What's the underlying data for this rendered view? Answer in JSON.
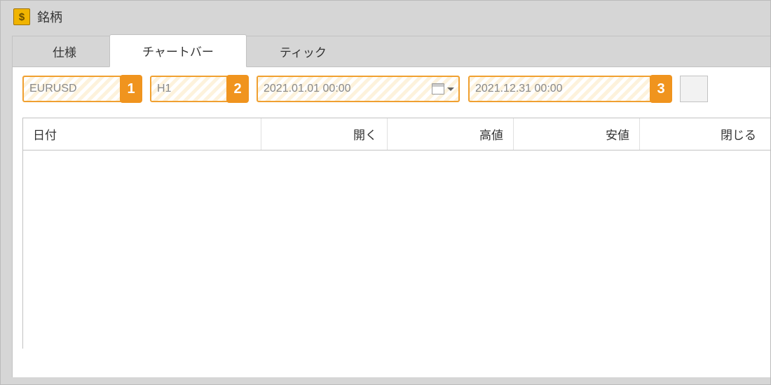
{
  "window": {
    "title": "銘柄",
    "icon_glyph": "$"
  },
  "tabs": [
    {
      "label": "仕様",
      "active": false
    },
    {
      "label": "チャートバー",
      "active": true
    },
    {
      "label": "ティック",
      "active": false
    }
  ],
  "toolbar": {
    "symbol": {
      "value": "EURUSD",
      "callout": "1"
    },
    "timeframe": {
      "value": "H1",
      "callout": "2"
    },
    "date_from": {
      "value": "2021.01.01 00:00"
    },
    "date_to": {
      "value": "2021.12.31 00:00",
      "callout": "3"
    }
  },
  "table": {
    "columns": {
      "date": "日付",
      "open": "開く",
      "high": "高値",
      "low": "安値",
      "close": "閉じる"
    }
  }
}
